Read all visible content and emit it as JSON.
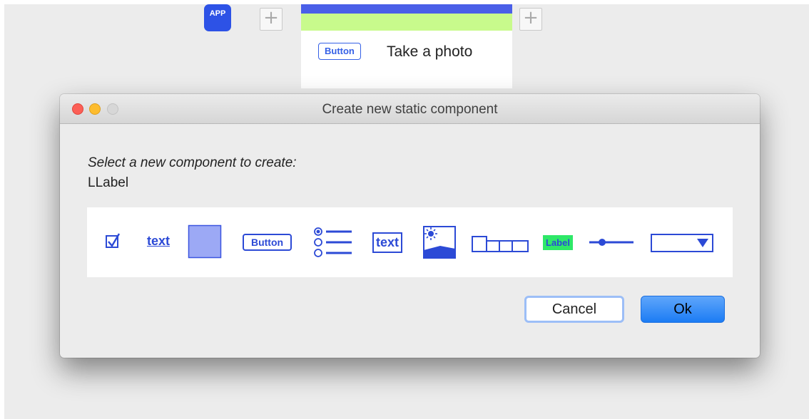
{
  "background": {
    "app_badge": "APP",
    "preview": {
      "button_label": "Button",
      "label_text": "Take a photo"
    }
  },
  "dialog": {
    "title": "Create new static component",
    "prompt": "Select a new component to create:",
    "selected": "LLabel",
    "palette": [
      {
        "name": "checkbox",
        "icon": "checkbox-icon"
      },
      {
        "name": "link",
        "icon": "link-text-icon",
        "text": "text"
      },
      {
        "name": "panel",
        "icon": "panel-icon"
      },
      {
        "name": "button",
        "icon": "button-icon",
        "text": "Button"
      },
      {
        "name": "radio-list",
        "icon": "radio-list-icon"
      },
      {
        "name": "text-field",
        "icon": "text-field-icon",
        "text": "text"
      },
      {
        "name": "image",
        "icon": "image-icon"
      },
      {
        "name": "tabs",
        "icon": "tabs-icon"
      },
      {
        "name": "label",
        "icon": "label-icon",
        "text": "Label"
      },
      {
        "name": "slider",
        "icon": "slider-icon"
      },
      {
        "name": "dropdown",
        "icon": "dropdown-icon"
      }
    ],
    "cancel_label": "Cancel",
    "ok_label": "Ok"
  },
  "colors": {
    "accent": "#3560e6",
    "label_green": "#2ee868",
    "ok_blue": "#1c7cf4"
  }
}
